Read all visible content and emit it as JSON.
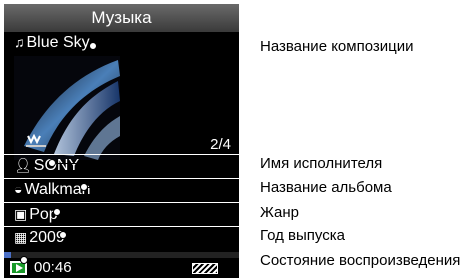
{
  "header": {
    "title": "Музыка"
  },
  "track": {
    "song": "Blue Sky",
    "artist": "SONY",
    "album": "Walkman",
    "genre": "Pop",
    "year": "2009",
    "index": "2/4",
    "elapsed": "00:46",
    "progress": 0.03
  },
  "icons": {
    "song": "music-note-icon",
    "artist": "person-icon",
    "album": "disc-icon",
    "genre": "genre-icon",
    "year": "calendar-icon",
    "play": "play-icon",
    "battery": "battery-icon"
  },
  "callouts": {
    "song_name": "Название композиции",
    "artist_name": "Имя исполнителя",
    "album_name": "Название альбома",
    "genre": "Жанр",
    "year": "Год выпуска",
    "playback_state": "Состояние воспроизведения"
  },
  "colors": {
    "play_green": "#1a9a2a",
    "progress_blue": "#4a6fc6"
  }
}
